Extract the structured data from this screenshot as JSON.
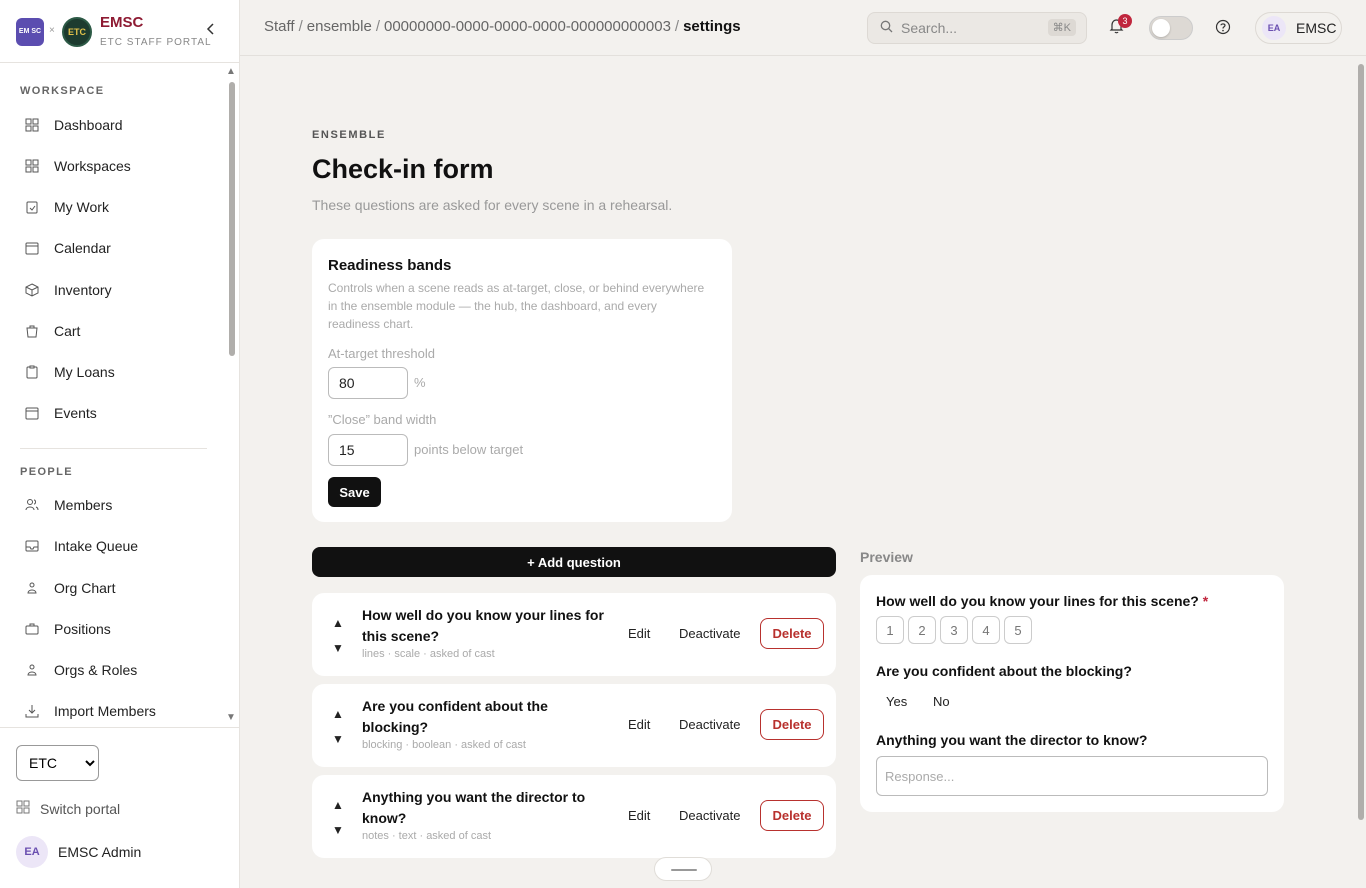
{
  "brand": {
    "logo_a_text": "EM SC",
    "logo_separator": "×",
    "logo_b_text": "ETC",
    "title": "EMSC",
    "subtitle": "ETC STAFF PORTAL"
  },
  "sidebar": {
    "workspace_label": "WORKSPACE",
    "workspace_items": [
      {
        "label": "Dashboard",
        "icon": "dashboard-icon"
      },
      {
        "label": "Workspaces",
        "icon": "grid-icon"
      },
      {
        "label": "My Work",
        "icon": "clipboard-check-icon"
      },
      {
        "label": "Calendar",
        "icon": "calendar-icon"
      },
      {
        "label": "Inventory",
        "icon": "box-icon"
      },
      {
        "label": "Cart",
        "icon": "cart-icon"
      },
      {
        "label": "My Loans",
        "icon": "clipboard-icon"
      },
      {
        "label": "Events",
        "icon": "calendar-icon"
      }
    ],
    "people_label": "PEOPLE",
    "people_items": [
      {
        "label": "Members",
        "icon": "users-icon"
      },
      {
        "label": "Intake Queue",
        "icon": "inbox-icon"
      },
      {
        "label": "Org Chart",
        "icon": "org-chart-icon"
      },
      {
        "label": "Positions",
        "icon": "briefcase-icon"
      },
      {
        "label": "Orgs & Roles",
        "icon": "org-chart-icon"
      },
      {
        "label": "Import Members",
        "icon": "download-icon"
      }
    ],
    "org_select": "ETC",
    "switch_portal": "Switch portal",
    "user_initials": "EA",
    "user_name": "EMSC Admin"
  },
  "topbar": {
    "breadcrumbs": [
      "Staff",
      "ensemble",
      "00000000-0000-0000-0000-000000000003",
      "settings"
    ],
    "search_placeholder": "Search...",
    "search_shortcut": "⌘K",
    "notification_count": "3",
    "user_initials": "EA",
    "user_label": "EMSC"
  },
  "page": {
    "eyebrow": "ENSEMBLE",
    "title": "Check-in form",
    "subtitle": "These questions are asked for every scene in a rehearsal."
  },
  "bands": {
    "title": "Readiness bands",
    "description": "Controls when a scene reads as at-target, close, or behind everywhere in the ensemble module — the hub, the dashboard, and every readiness chart.",
    "at_target_label": "At-target threshold",
    "at_target_value": "80",
    "at_target_unit": "%",
    "close_label": "”Close” band width",
    "close_value": "15",
    "close_unit": "points below target",
    "save_label": "Save"
  },
  "questions": {
    "add_label": "+ Add question",
    "edit_label": "Edit",
    "deactivate_label": "Deactivate",
    "delete_label": "Delete",
    "items": [
      {
        "text": "How well do you know your lines for this scene?",
        "meta": "lines · scale · asked of cast"
      },
      {
        "text": "Are you confident about the blocking?",
        "meta": "blocking · boolean · asked of cast"
      },
      {
        "text": "Anything you want the director to know?",
        "meta": "notes · text · asked of cast"
      }
    ]
  },
  "preview": {
    "label": "Preview",
    "q1": "How well do you know your lines for this scene?",
    "q1_required": "*",
    "scale": [
      "1",
      "2",
      "3",
      "4",
      "5"
    ],
    "q2": "Are you confident about the blocking?",
    "yes": "Yes",
    "no": "No",
    "q3": "Anything you want the director to know?",
    "response_placeholder": "Response..."
  }
}
